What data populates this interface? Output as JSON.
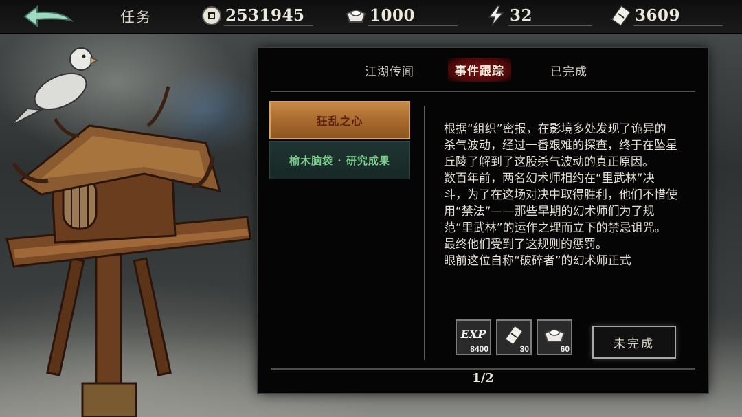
{
  "topbar": {
    "title": "任务",
    "resources": [
      {
        "name": "coin",
        "icon": "copper-coin-icon",
        "value": "2531945"
      },
      {
        "name": "ingot",
        "icon": "silver-ingot-icon",
        "value": "1000"
      },
      {
        "name": "stamina",
        "icon": "lightning-icon",
        "value": "32"
      },
      {
        "name": "scroll",
        "icon": "scroll-ticket-icon",
        "value": "3609"
      }
    ]
  },
  "tabs": [
    {
      "label": "江湖传闻",
      "active": false
    },
    {
      "label": "事件跟踪",
      "active": true
    },
    {
      "label": "已完成",
      "active": false
    }
  ],
  "quests": [
    {
      "label": "狂乱之心",
      "selected": true
    },
    {
      "label": "榆木脑袋 · 研究成果",
      "selected": false
    }
  ],
  "description": {
    "paragraph1": "根据“组织”密报，在影境多处发现了诡异的杀气波动，经过一番艰难的探查，终于在坠星丘陵了解到了这股杀气波动的真正原因。",
    "paragraph2": "数百年前，两名幻术师相约在“里武林”决斗，为了在这场对决中取得胜利，他们不惜使用“禁法”——那些早期的幻术师们为了规范“里武林”的运作之理而立下的禁忌诅咒。最终他们受到了这规则的惩罚。",
    "paragraph3": "眼前这位自称“破碎者”的幻术师正式"
  },
  "rewards": [
    {
      "icon": "exp-icon",
      "label": "EXP",
      "value": "8400"
    },
    {
      "icon": "scroll-ticket-icon",
      "value": "30"
    },
    {
      "icon": "silver-ingot-icon",
      "value": "60"
    }
  ],
  "status_button": "未完成",
  "pager": "1/2",
  "colors": {
    "active_tab": "#7a1212",
    "selected_item": "#b97a3a",
    "normal_item_text": "#7ccf8c"
  }
}
